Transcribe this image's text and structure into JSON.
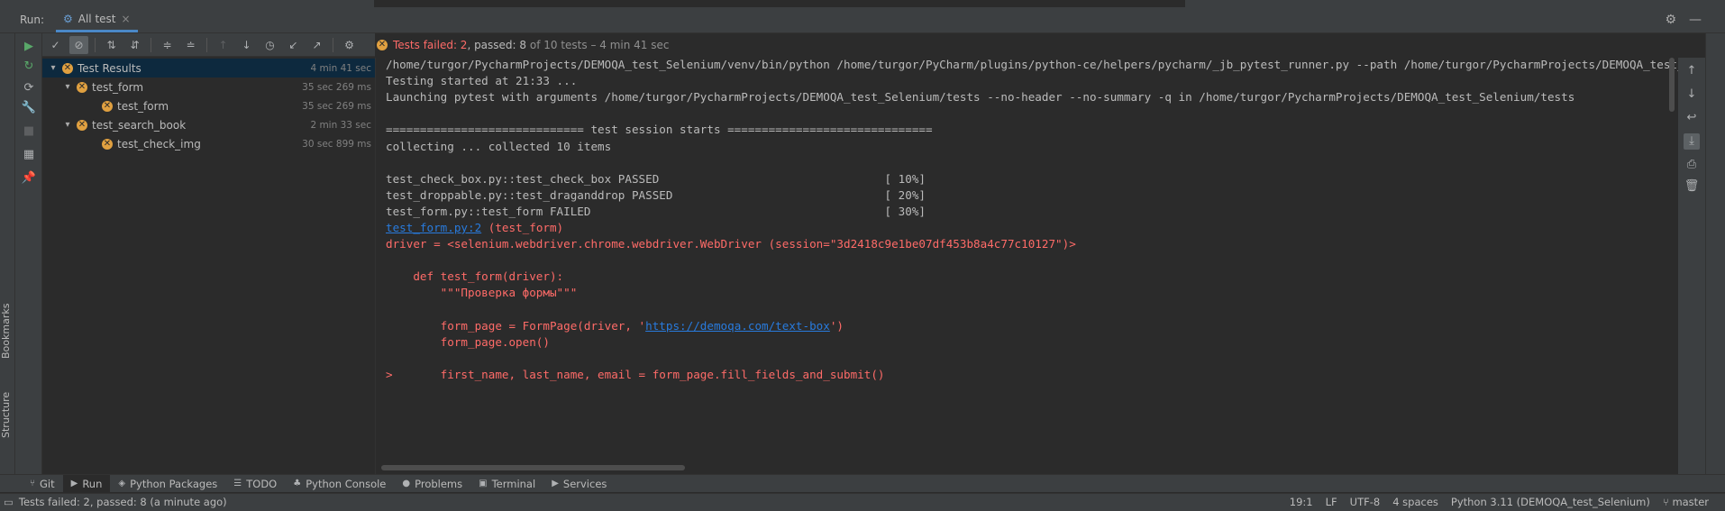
{
  "run_header": {
    "run_label": "Run:",
    "tab_title": "All test",
    "tab_close": "×",
    "settings_icon": "⚙",
    "minimize_icon": "—"
  },
  "ide_stripe": {
    "bookmarks_label": "Bookmarks",
    "structure_label": "Structure"
  },
  "status_line": {
    "summary_fail": "Tests failed: 2",
    "summary_passed": ", passed: 8",
    "summary_rest": " of 10 tests – 4 min 41 sec"
  },
  "tree": [
    {
      "label": "Test Results",
      "time": "4 min 41 sec",
      "depth": 0,
      "expanded": true,
      "selected": true
    },
    {
      "label": "test_form",
      "time": "35 sec 269 ms",
      "depth": 1,
      "expanded": true,
      "selected": false
    },
    {
      "label": "test_form",
      "time": "35 sec 269 ms",
      "depth": 2,
      "expanded": false,
      "selected": false
    },
    {
      "label": "test_search_book",
      "time": "2 min 33 sec",
      "depth": 1,
      "expanded": true,
      "selected": false
    },
    {
      "label": "test_check_img",
      "time": "30 sec 899 ms",
      "depth": 2,
      "expanded": false,
      "selected": false
    }
  ],
  "console": {
    "lines": [
      {
        "text": "/home/turgor/PycharmProjects/DEMOQA_test_Selenium/venv/bin/python /home/turgor/PyCharm/plugins/python-ce/helpers/pycharm/_jb_pytest_runner.py --path /home/turgor/PycharmProjects/DEMOQA_test_Selenium/tests",
        "kind": "normal"
      },
      {
        "text": "Testing started at 21:33 ...",
        "kind": "normal"
      },
      {
        "text": "Launching pytest with arguments /home/turgor/PycharmProjects/DEMOQA_test_Selenium/tests --no-header --no-summary -q in /home/turgor/PycharmProjects/DEMOQA_test_Selenium/tests",
        "kind": "normal"
      },
      {
        "text": "",
        "kind": "normal"
      },
      {
        "text": "============================= test session starts ==============================",
        "kind": "normal"
      },
      {
        "text": "collecting ... collected 10 items",
        "kind": "normal"
      },
      {
        "text": "",
        "kind": "normal"
      },
      {
        "text": "test_check_box.py::test_check_box PASSED                                 [ 10%]",
        "kind": "normal"
      },
      {
        "text": "test_droppable.py::test_draganddrop PASSED                               [ 20%]",
        "kind": "normal"
      },
      {
        "text": "test_form.py::test_form FAILED                                           [ 30%]",
        "kind": "normal"
      },
      {
        "text": "",
        "kind": "linkline"
      },
      {
        "text": "driver = <selenium.webdriver.chrome.webdriver.WebDriver (session=\"3d2418c9e1be07df453b8a4c77c10127\")>",
        "kind": "error"
      },
      {
        "text": "",
        "kind": "normal"
      },
      {
        "text": "    def test_form(driver):",
        "kind": "error"
      },
      {
        "text": "        \"\"\"Проверка формы\"\"\"",
        "kind": "error"
      },
      {
        "text": "",
        "kind": "normal"
      },
      {
        "text": "",
        "kind": "urlline"
      },
      {
        "text": "        form_page.open()",
        "kind": "error"
      },
      {
        "text": "",
        "kind": "normal"
      },
      {
        "text": ">       first_name, last_name, email = form_page.fill_fields_and_submit()",
        "kind": "error"
      }
    ],
    "link_text": "test_form.py:2",
    "link_suffix": " (test_form)",
    "url_prefix": "        form_page = FormPage(driver, '",
    "url_text": "https://demoqa.com/text-box",
    "url_suffix": "')"
  },
  "tool_windows": [
    {
      "label": "Git",
      "icon": "⑂",
      "active": false
    },
    {
      "label": "Run",
      "icon": "▶",
      "active": true
    },
    {
      "label": "Python Packages",
      "icon": "◈",
      "active": false
    },
    {
      "label": "TODO",
      "icon": "☰",
      "active": false
    },
    {
      "label": "Python Console",
      "icon": "♣",
      "active": false
    },
    {
      "label": "Problems",
      "icon": "●",
      "active": false
    },
    {
      "label": "Terminal",
      "icon": "▣",
      "active": false
    },
    {
      "label": "Services",
      "icon": "▶",
      "active": false
    }
  ],
  "status_bar": {
    "message": "Tests failed: 2, passed: 8 (a minute ago)",
    "position": "19:1",
    "line_sep": "LF",
    "encoding": "UTF-8",
    "indent": "4 spaces",
    "interpreter": "Python 3.11 (DEMOQA_test_Selenium)",
    "branch": "master"
  },
  "colors": {
    "fail": "#ff6b68",
    "link": "#287bde",
    "accent": "#4a88c7",
    "run_green": "#59a869"
  }
}
